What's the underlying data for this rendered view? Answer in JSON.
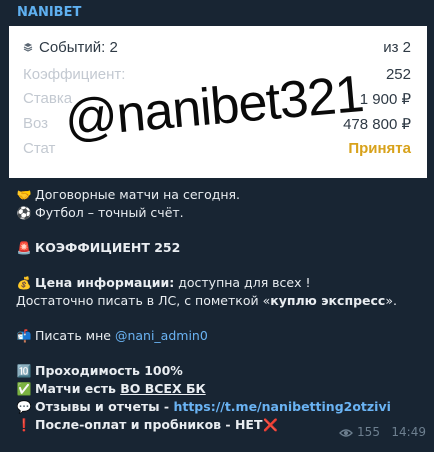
{
  "sender": "NANIBET",
  "bet_screenshot": {
    "rows": [
      {
        "label": "Событий: 2",
        "value": "из 2"
      },
      {
        "label": "Коэффициент:",
        "value": "252"
      },
      {
        "label": "Ставка",
        "value": "1 900 ₽"
      },
      {
        "label": "Воз",
        "value": "478 800 ₽"
      },
      {
        "label": "Стат",
        "value": "Принята"
      }
    ],
    "watermark": "@nanibet321"
  },
  "lines": {
    "l1_emoji": "🤝",
    "l1": "Договорные матчи на сегодня.",
    "l2_emoji": "⚽",
    "l2": "Футбол – точный счёт.",
    "l3_emoji": "🚨",
    "l3": "КОЭФФИЦИЕНТ 252",
    "l4_emoji": "💰",
    "l4_bold": "Цена информации:",
    "l4_rest": " доступна для всех !",
    "l5_a": "Достаточно писать в ЛС, с пометкой «",
    "l5_bold": "куплю экспресс",
    "l5_b": "».",
    "l6_emoji": "📬",
    "l6_text": "Писать мне ",
    "l6_link": "@nani_admin0",
    "l7_emoji": "🔟",
    "l7": "Проходимость 100%",
    "l8_emoji": "✅",
    "l8_text": "Матчи есть ",
    "l8_u": "ВО ВСЕХ БК",
    "l9_emoji": "💬",
    "l9_text": "Отзывы и отчеты - ",
    "l9_link": "https://t.me/nanibetting2otzivi",
    "l10_emoji": "❗",
    "l10": "После-оплат и пробников - НЕТ",
    "l10_end": "❌"
  },
  "meta": {
    "views": "155",
    "time": "14:49"
  },
  "colors": {
    "link": "#6ab3f3",
    "accepted": "#d8a21b",
    "bubble": "#182533"
  }
}
